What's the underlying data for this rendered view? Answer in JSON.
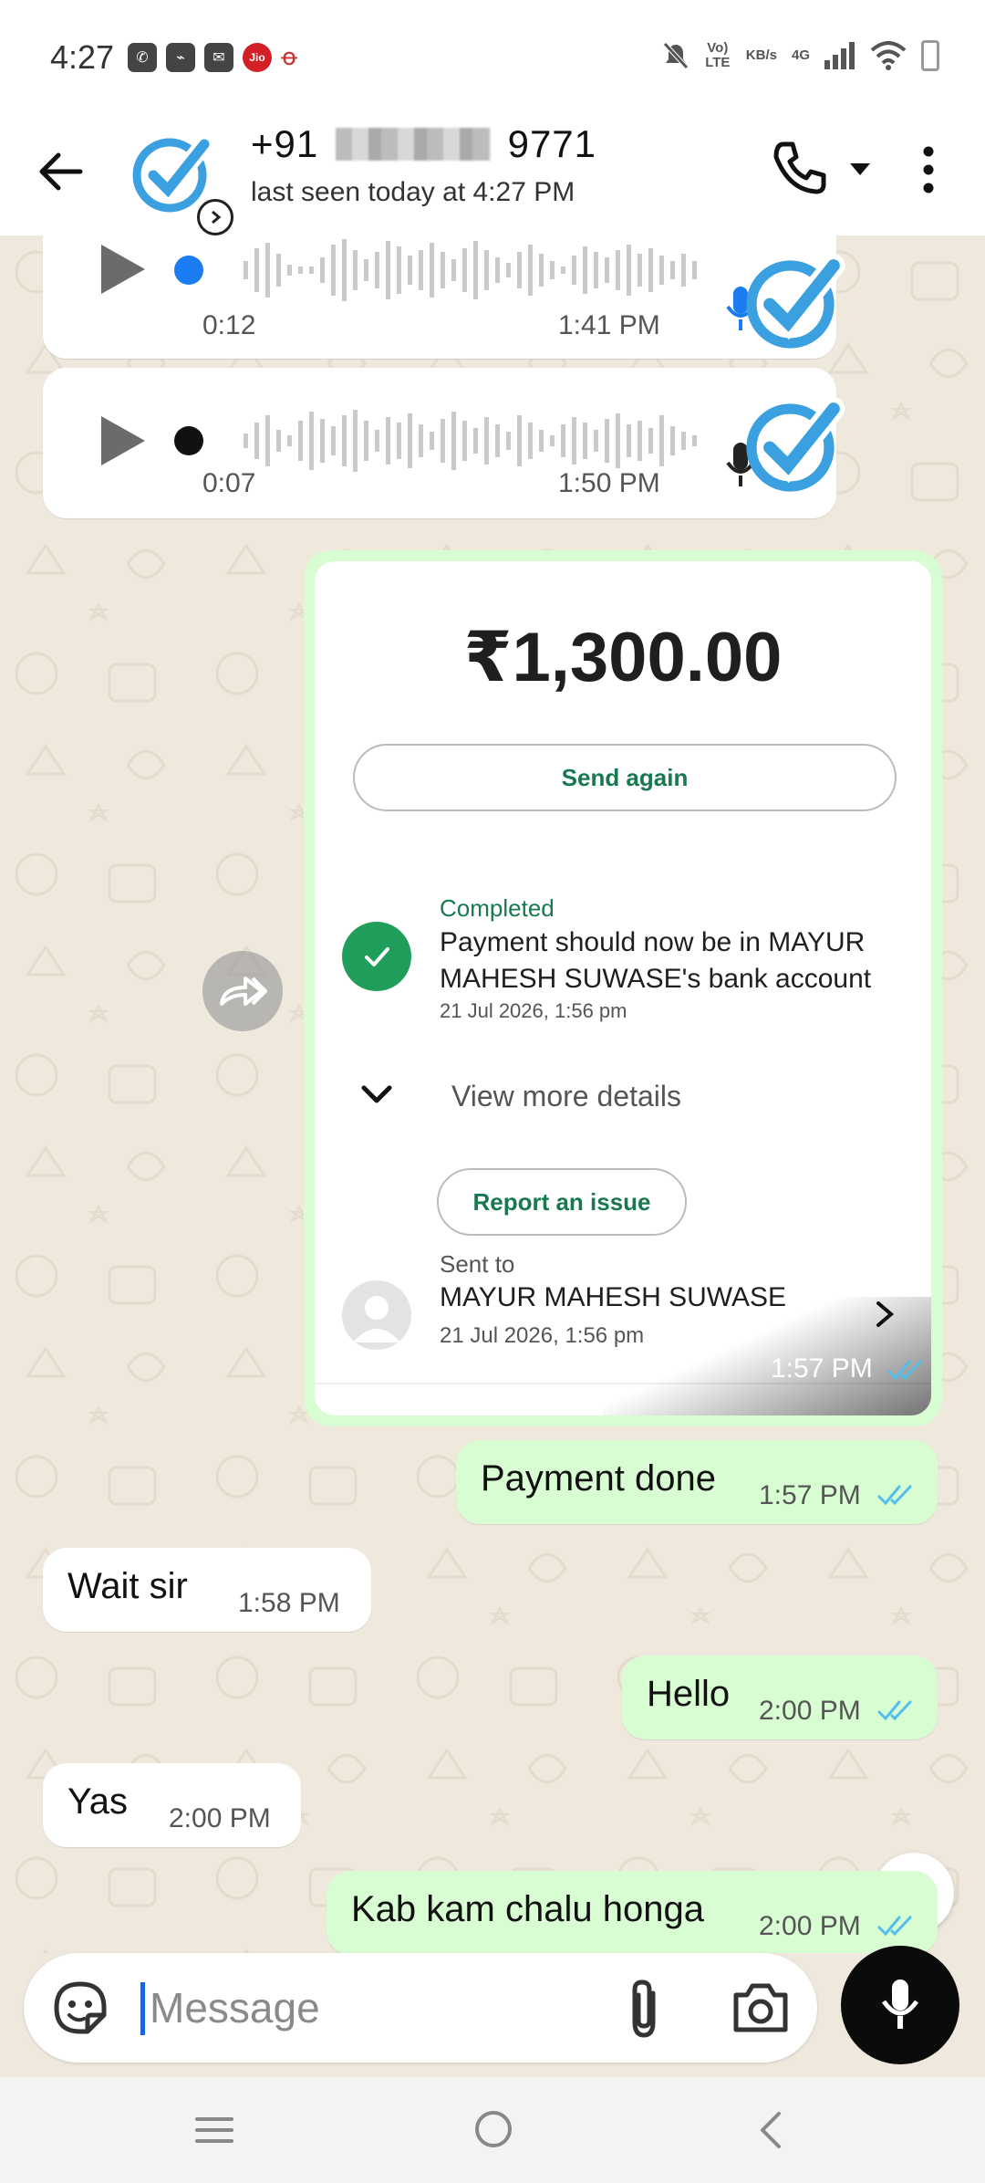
{
  "status_bar": {
    "time": "4:27",
    "network": "4G",
    "volte": "Vo) LTE",
    "speed": "KB/s"
  },
  "header": {
    "contact_name_prefix": "+91",
    "contact_name_suffix": "9771",
    "last_seen": "last seen today at 4:27 PM",
    "icons": [
      "back-arrow-icon",
      "call-icon",
      "dropdown-caret-icon",
      "more-vert-icon"
    ]
  },
  "messages": {
    "voice1": {
      "duration": "0:12",
      "time": "1:41 PM",
      "played": false
    },
    "voice2": {
      "duration": "0:07",
      "time": "1:50 PM",
      "played": true
    },
    "payment": {
      "amount": "₹1,300.00",
      "send_again_label": "Send again",
      "status": "Completed",
      "description": "Payment should now be in MAYUR MAHESH SUWASE's bank account",
      "date": "21 Jul 2026, 1:56 pm",
      "view_more_label": "View more details",
      "report_label": "Report an issue",
      "sent_to_label": "Sent to",
      "recipient_name": "MAYUR MAHESH SUWASE",
      "recipient_date": "21 Jul 2026, 1:56 pm",
      "time": "1:57 PM"
    },
    "out1": {
      "text": "Payment done",
      "time": "1:57 PM"
    },
    "in1": {
      "text": "Wait sir",
      "time": "1:58 PM"
    },
    "out2": {
      "text": "Hello",
      "time": "2:00 PM"
    },
    "in2": {
      "text": "Yas",
      "time": "2:00 PM"
    },
    "out3": {
      "text": "Kab kam chalu honga",
      "time": "2:00 PM"
    }
  },
  "input": {
    "placeholder": "Message"
  },
  "colors": {
    "accent_green": "#18794e",
    "outgoing_bubble": "#d9fdd3",
    "read_ticks": "#53bdeb",
    "chat_background": "#efe9dd"
  }
}
